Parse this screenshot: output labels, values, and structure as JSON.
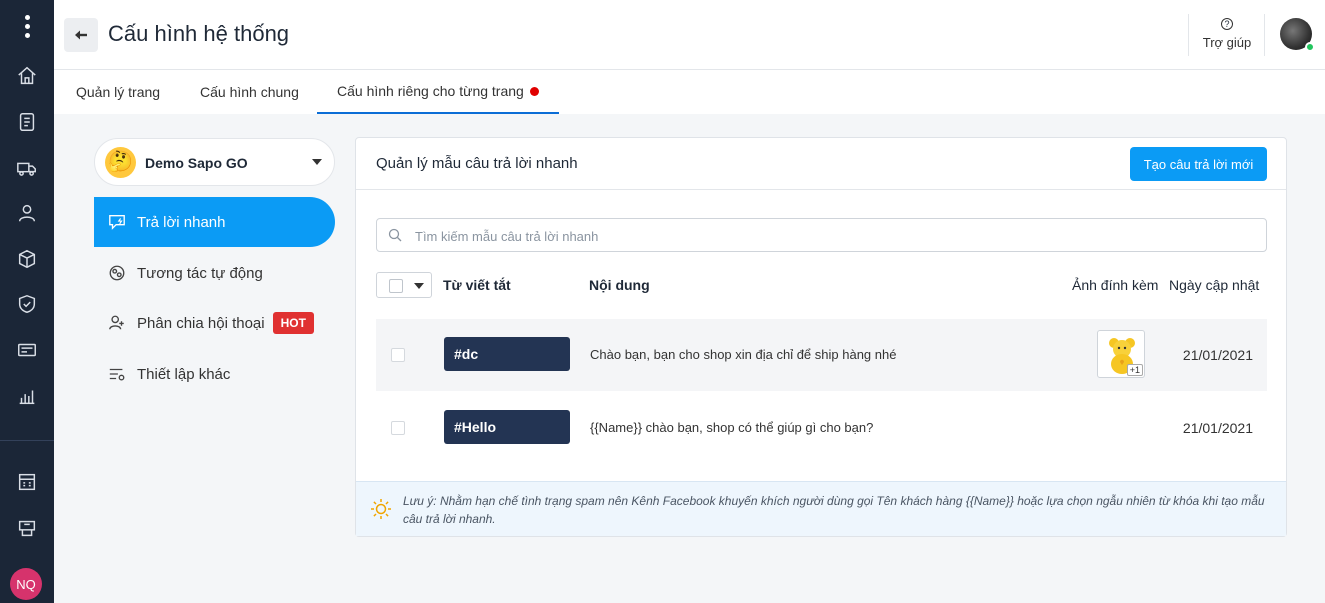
{
  "header": {
    "title": "Cấu hình hệ thống",
    "help_label": "Trợ giúp"
  },
  "rail": {
    "icons": [
      "home-icon",
      "invoice-icon",
      "delivery-truck-icon",
      "customer-icon",
      "product-box-icon",
      "shield-check-icon",
      "cashbook-icon",
      "report-chart-icon",
      "store-icon",
      "pos-icon"
    ],
    "user_initials": "NQ"
  },
  "tabs": [
    {
      "label": "Quản lý trang",
      "active": false
    },
    {
      "label": "Cấu hình chung",
      "active": false
    },
    {
      "label": "Cấu hình riêng cho từng trang",
      "active": true
    }
  ],
  "page_selector": {
    "name": "Demo Sapo GO",
    "emoji": "🤔"
  },
  "menu": [
    {
      "label": "Trả lời nhanh",
      "icon": "quick-reply-icon",
      "active": true
    },
    {
      "label": "Tương tác tự động",
      "icon": "auto-interaction-icon",
      "active": false
    },
    {
      "label": "Phân chia hội thoại",
      "icon": "assign-user-icon",
      "active": false,
      "badge": "HOT"
    },
    {
      "label": "Thiết lập khác",
      "icon": "settings-list-icon",
      "active": false
    }
  ],
  "main": {
    "title": "Quản lý mẫu câu trả lời nhanh",
    "new_button": "Tạo câu trả lời mới",
    "search_placeholder": "Tìm kiếm mẫu câu trả lời nhanh",
    "columns": {
      "shortcut": "Từ viết tắt",
      "content": "Nội dung",
      "attachment": "Ảnh đính kèm",
      "updated": "Ngày cập nhật"
    },
    "rows": [
      {
        "shortcut": "#dc",
        "content": "Chào bạn, bạn cho shop xin địa chỉ để ship hàng nhé",
        "attachment_extra": "+1",
        "updated": "21/01/2021"
      },
      {
        "shortcut": "#Hello",
        "content": "{{Name}} chào bạn, shop có thể giúp gì cho bạn?",
        "updated": "21/01/2021"
      }
    ],
    "note": "Lưu ý: Nhằm hạn chế tình trạng spam nên Kênh Facebook khuyến khích người dùng gọi Tên khách hàng {{Name}} hoặc lựa chọn ngẫu nhiên từ khóa khi tạo mẫu câu trả lời nhanh."
  },
  "colors": {
    "rail_bg": "#1b2637",
    "accent": "#0b9bf5",
    "tag_bg": "#233453",
    "hot": "#e03131",
    "tab_underline": "#0b6dd6"
  }
}
